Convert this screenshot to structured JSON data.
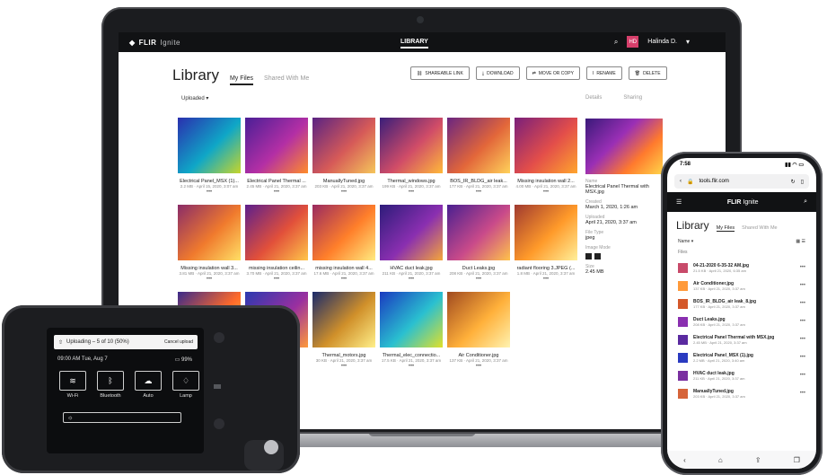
{
  "laptop": {
    "brand": "FLIR",
    "brand_sub": "Ignite",
    "nav_center": "LIBRARY",
    "avatar_initials": "HD",
    "user_name": "Halinda D.",
    "library_title": "Library",
    "tabs": [
      "My Files",
      "Shared With Me"
    ],
    "toolbar": [
      "SHAREABLE LINK",
      "DOWNLOAD",
      "MOVE OR COPY",
      "RENAME",
      "DELETE"
    ],
    "sort_label": "Uploaded",
    "side_tabs": [
      "Details",
      "Sharing"
    ],
    "files": [
      {
        "name": "Electrical Panel_MSX (1)...",
        "meta": "2.2 MB · April 15, 2020, 3:07 am",
        "colors": [
          "#2a2fae",
          "#0fa7c7",
          "#c7d52a"
        ]
      },
      {
        "name": "Electrical Panel Thermal ...",
        "meta": "2.45 MB · April 21, 2020, 3:37 am",
        "colors": [
          "#4a1f96",
          "#b32fa5",
          "#ff8c2a"
        ]
      },
      {
        "name": "ManuallyTuned.jpg",
        "meta": "203 KB · April 21, 2020, 3:37 am",
        "colors": [
          "#5a2383",
          "#d65a58",
          "#f5c65a"
        ]
      },
      {
        "name": "Thermal_windows.jpg",
        "meta": "199 KB · April 21, 2020, 3:37 am",
        "colors": [
          "#3a1e7a",
          "#d04c68",
          "#ffb93a"
        ]
      },
      {
        "name": "BOS_IR_BLDG_air leak...",
        "meta": "177 KB · April 21, 2020, 3:37 am",
        "colors": [
          "#6a2580",
          "#e2663a",
          "#ffd25a"
        ]
      },
      {
        "name": "Missing insulation wall 2...",
        "meta": "4.00 MB · April 21, 2020, 3:37 am",
        "colors": [
          "#7a1f7a",
          "#e34e4a",
          "#ffa52d"
        ]
      },
      {
        "name": "Missing insulation wall 3...",
        "meta": "3.81 MB · April 21, 2020, 3:37 am",
        "colors": [
          "#8a2c68",
          "#f07a2d",
          "#ffe066"
        ]
      },
      {
        "name": "missing insulation ceilin...",
        "meta": "3.70 MB · April 21, 2020, 3:37 am",
        "colors": [
          "#5d1f8c",
          "#e2503a",
          "#ffc64a"
        ]
      },
      {
        "name": "missing insulation wall 4...",
        "meta": "17.6 MB · April 21, 2020, 3:37 am",
        "colors": [
          "#9a2a60",
          "#ff7f2a",
          "#ffeb80"
        ]
      },
      {
        "name": "HVAC duct leak.jpg",
        "meta": "211 KB · April 21, 2020, 3:37 am",
        "colors": [
          "#2d1c7a",
          "#8a2fb0",
          "#f5a63a"
        ]
      },
      {
        "name": "Duct Leaks.jpg",
        "meta": "208 KB · April 21, 2020, 3:37 am",
        "colors": [
          "#4a2090",
          "#c94a8a",
          "#ffc24a"
        ]
      },
      {
        "name": "radiant flooring 3.JPEG (...",
        "meta": "1.8 MB · April 21, 2020, 3:37 am",
        "colors": [
          "#a03a30",
          "#ff9a2a",
          "#fff09a"
        ]
      },
      {
        "name": "",
        "meta": "",
        "colors": [
          "#3a2a8a",
          "#ff6a2a",
          "#ffd84a"
        ]
      },
      {
        "name": "",
        "meta": "",
        "colors": [
          "#2a3ab0",
          "#9a2fa0",
          "#ff9a3a"
        ]
      },
      {
        "name": "Thermal_motors.jpg",
        "meta": "30 KB · April 21, 2020, 3:37 am",
        "colors": [
          "#1a2a6a",
          "#d0902a",
          "#fff08a"
        ]
      },
      {
        "name": "Thermal_elec_connectio...",
        "meta": "17.5 KB · April 21, 2020, 3:37 am",
        "colors": [
          "#1a3ac0",
          "#2ac0d0",
          "#e0e02a"
        ]
      },
      {
        "name": "Air Conditioner.jpg",
        "meta": "137 KB · April 21, 2020, 3:37 am",
        "colors": [
          "#a04a20",
          "#ffb03a",
          "#fff3b0"
        ]
      }
    ],
    "details": {
      "name_label": "Name",
      "name_value": "Electrical Panel Thermal with MSX.jpg",
      "created_label": "Created",
      "created_value": "March 1, 2020, 1:26 am",
      "uploaded_label": "Uploaded",
      "uploaded_value": "April 21, 2020, 3:37 am",
      "type_label": "File Type",
      "type_value": "jpeg",
      "mode_label": "Image Mode",
      "size_label": "Size",
      "size_value": "2.45 MB"
    }
  },
  "phone": {
    "time": "7:58",
    "url": "tools.flir.com",
    "brand": "FLIR",
    "brand_sub": "Ignite",
    "title": "Library",
    "tabs": [
      "My Files",
      "Shared With Me"
    ],
    "sort_label": "Name",
    "group_label": "Files",
    "files": [
      {
        "name": "04-21-2020 6-35-32 AM.jpg",
        "meta": "21.5 KB · April 21, 2020, 6:35 am",
        "color": "#c84a6a"
      },
      {
        "name": "Air Conditioner.jpg",
        "meta": "137 KB · April 21, 2020, 3:37 am",
        "color": "#ff9a3a"
      },
      {
        "name": "BOS_IR_BLDG_air leak_8.jpg",
        "meta": "177 KB · April 21, 2020, 3:37 am",
        "color": "#d4582a"
      },
      {
        "name": "Duct Leaks.jpg",
        "meta": "208 KB · April 21, 2020, 3:37 am",
        "color": "#8a2fb0"
      },
      {
        "name": "Electrical Panel Thermal with MSX.jpg",
        "meta": "2.45 MB · April 21, 2020, 3:37 am",
        "color": "#5a2aa0"
      },
      {
        "name": "Electrical Panel_MSX (1).jpg",
        "meta": "2.2 MB · April 21, 2020, 3:40 am",
        "color": "#2a3ac0"
      },
      {
        "name": "HVAC duct leak.jpg",
        "meta": "211 KB · April 21, 2020, 3:37 am",
        "color": "#7a2fa0"
      },
      {
        "name": "ManuallyTuned.jpg",
        "meta": "203 KB · April 21, 2020, 3:37 am",
        "color": "#d6643a"
      }
    ]
  },
  "device": {
    "upload_text": "Uploading – 5 of 10 (50%)",
    "cancel_text": "Cancel upload",
    "status_time": "09:00 AM Tue, Aug 7",
    "battery": "99%",
    "quick_settings": [
      {
        "label": "Wi-Fi",
        "icon": "≋"
      },
      {
        "label": "Bluetooth",
        "icon": "ᛒ"
      },
      {
        "label": "Auto",
        "icon": "☁"
      },
      {
        "label": "Lamp",
        "icon": "♢"
      }
    ]
  }
}
